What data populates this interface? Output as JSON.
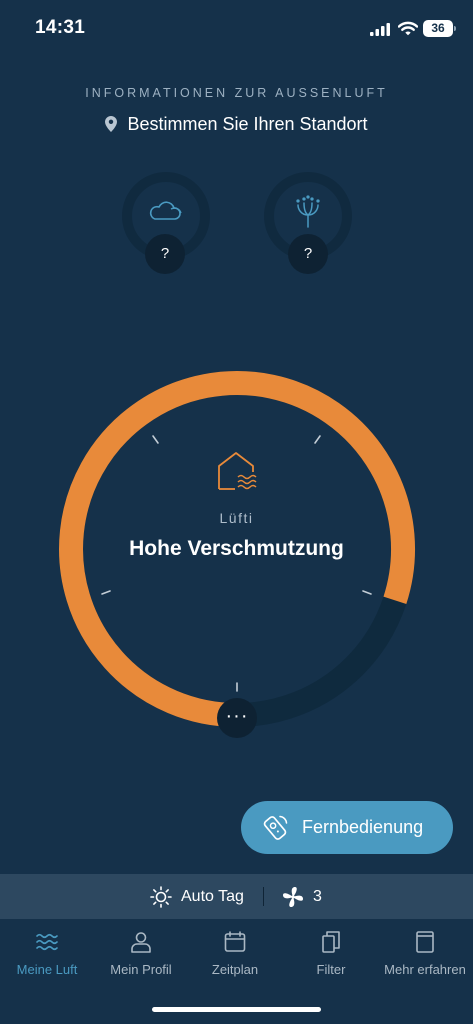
{
  "status_bar": {
    "time": "14:31",
    "battery": "36"
  },
  "air_info": {
    "title": "INFORMATIONEN ZUR AUSSENLUFT",
    "location_label": "Bestimmen Sie Ihren Standort",
    "weather_value": "?",
    "pollen_value": "?"
  },
  "main_gauge": {
    "name": "Lüfti",
    "status": "Hohe Verschmutzung",
    "more_label": "···",
    "level_fraction": 0.8,
    "colors": {
      "active": "#e88a3a",
      "track": "#0f2a3e"
    }
  },
  "remote_button": {
    "label": "Fernbedienung"
  },
  "mode_bar": {
    "mode": "Auto Tag",
    "fan_level": "3"
  },
  "tabs": [
    {
      "label": "Meine Luft",
      "icon": "waves-icon",
      "active": true
    },
    {
      "label": "Mein Profil",
      "icon": "person-icon",
      "active": false
    },
    {
      "label": "Zeitplan",
      "icon": "calendar-icon",
      "active": false
    },
    {
      "label": "Filter",
      "icon": "filter-icon",
      "active": false
    },
    {
      "label": "Mehr erfahren",
      "icon": "book-icon",
      "active": false
    }
  ],
  "colors": {
    "background": "#15314a",
    "accent": "#4a9ac1",
    "warning": "#e88a3a"
  }
}
